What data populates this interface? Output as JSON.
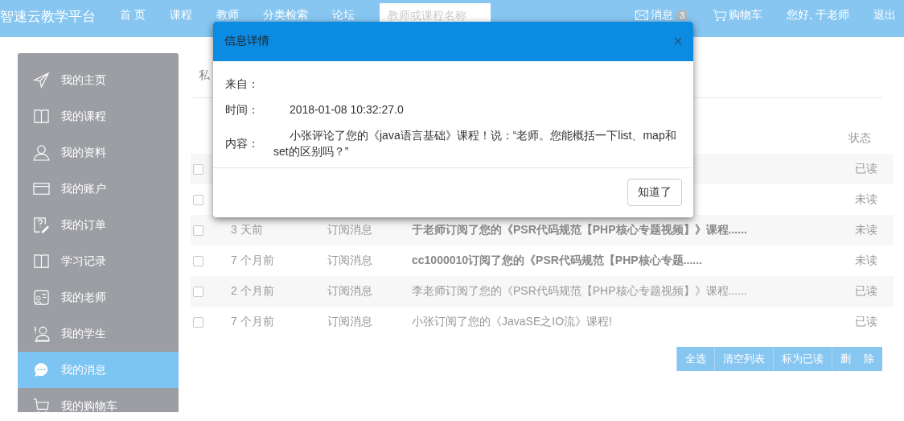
{
  "nav": {
    "brand": "智速云教学平台",
    "items": [
      {
        "label": "首 页",
        "selected": false
      },
      {
        "label": "课程",
        "selected": false
      },
      {
        "label": "教师",
        "selected": false
      },
      {
        "label": "分类检索",
        "selected": false
      },
      {
        "label": "论坛",
        "selected": false
      }
    ],
    "search": {
      "placeholder": "教师或课程名称"
    },
    "messages": {
      "label": "消息",
      "count": "3"
    },
    "cart": "购物车",
    "greeting": "您好, 于老师",
    "logout": "退出"
  },
  "sidebar": {
    "items": [
      {
        "label": "我的主页",
        "kind": "send",
        "selected": false
      },
      {
        "label": "我的课程",
        "kind": "book",
        "selected": false
      },
      {
        "label": "我的资料",
        "kind": "user",
        "selected": false
      },
      {
        "label": "我的账户",
        "kind": "card",
        "selected": false
      },
      {
        "label": "我的订单",
        "kind": "order",
        "selected": false
      },
      {
        "label": "学习记录",
        "kind": "book",
        "selected": false
      },
      {
        "label": "我的老师",
        "kind": "teacher",
        "selected": false
      },
      {
        "label": "我的学生",
        "kind": "student",
        "selected": false
      },
      {
        "label": "我的消息",
        "kind": "chat",
        "selected": true
      },
      {
        "label": "我的购物车",
        "kind": "cart",
        "selected": false
      }
    ]
  },
  "tab_label": "私",
  "table": {
    "status_header": "状态",
    "rows": [
      {
        "checked": false,
        "status": "已读"
      },
      {
        "checked": false,
        "status": "未读"
      },
      {
        "checked": false,
        "unread": true,
        "time": "3 天前",
        "type": "订阅消息",
        "content": "于老师订阅了您的《PSR代码规范【PHP核心专题视频】》课程......",
        "status": "未读"
      },
      {
        "checked": false,
        "unread": true,
        "time": "7 个月前",
        "type": "订阅消息",
        "content": "cc1000010订阅了您的《PSR代码规范【PHP核心专题......",
        "status": "未读"
      },
      {
        "checked": false,
        "unread": false,
        "time": "2 个月前",
        "type": "订阅消息",
        "content": "李老师订阅了您的《PSR代码规范【PHP核心专题视频】》课程......",
        "status": "已读"
      },
      {
        "checked": false,
        "unread": false,
        "time": "7 个月前",
        "type": "订阅消息",
        "content": "小张订阅了您的《JavaSE之IO流》课程!",
        "status": "已读"
      }
    ]
  },
  "actions": [
    "全选",
    "清空列表",
    "标为已读",
    "删 除"
  ],
  "modal": {
    "title": "信息详情",
    "fields": [
      {
        "label": "来自："
      },
      {
        "label": "时间：",
        "value": "2018-01-08 10:32:27.0"
      },
      {
        "label": "内容：",
        "value": "小张评论了您的《java语言基础》课程！说：“老师。您能概括一下list、map和set的区别吗？”"
      }
    ],
    "button": "知道了"
  }
}
